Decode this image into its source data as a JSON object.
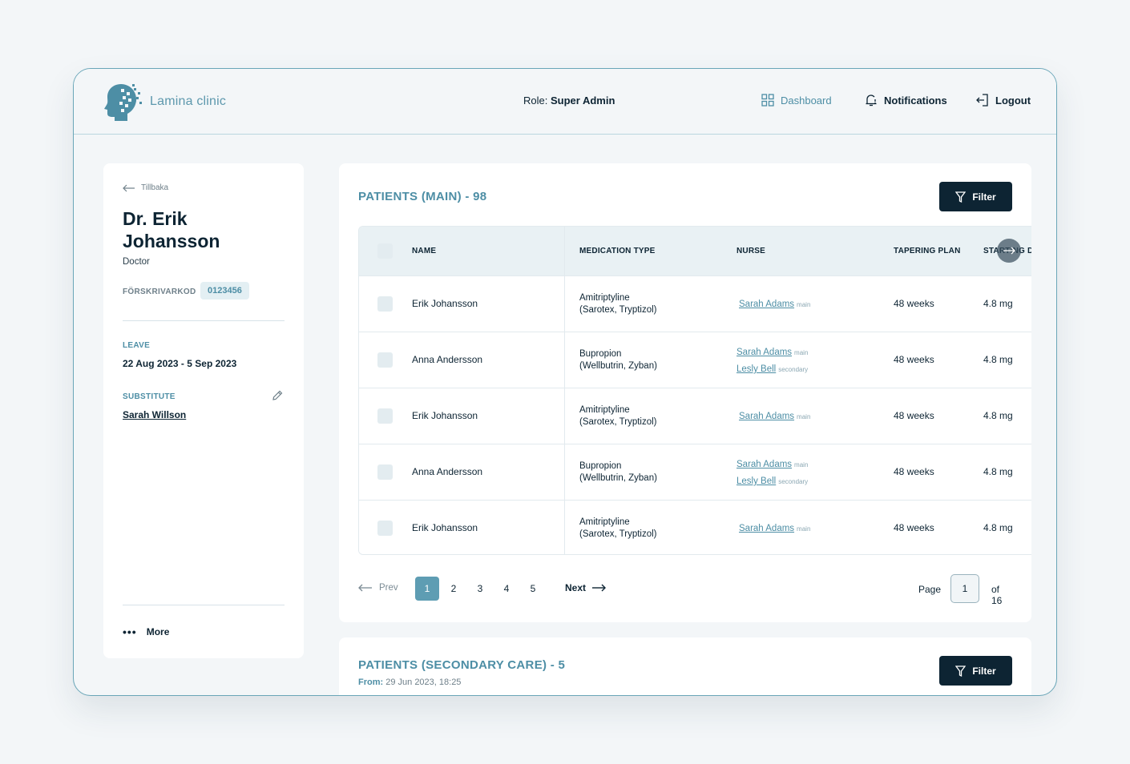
{
  "header": {
    "brand": "Lamina clinic",
    "role_label": "Role:",
    "role_value": "Super Admin",
    "nav": {
      "dashboard": "Dashboard",
      "notifications": "Notifications",
      "logout": "Logout"
    }
  },
  "profile": {
    "back_label": "Tillbaka",
    "name": "Dr. Erik Johansson",
    "role": "Doctor",
    "code_label": "FÖRSKRIVARKOD",
    "code_value": "0123456",
    "leave_label": "LEAVE",
    "leave_value": "22 Aug 2023 - 5 Sep 2023",
    "substitute_label": "SUBSTITUTE",
    "substitute_value": "Sarah Willson",
    "more_label": "More"
  },
  "main": {
    "title": "PATIENTS (MAIN) - 98",
    "filter_label": "Filter",
    "columns": [
      "NAME",
      "MEDICATION TYPE",
      "NURSE",
      "TAPERING PLAN",
      "STARTING D"
    ],
    "rows": [
      {
        "name": "Erik Johansson",
        "med_line1": "Amitriptyline",
        "med_line2": "(Sarotex, Tryptizol)",
        "nurses": [
          {
            "name": "Sarah Adams",
            "tag": "main"
          }
        ],
        "plan": "48 weeks",
        "dose": "4.8 mg"
      },
      {
        "name": "Anna Andersson",
        "med_line1": "Bupropion",
        "med_line2": "(Wellbutrin, Zyban)",
        "nurses": [
          {
            "name": "Sarah Adams",
            "tag": "main"
          },
          {
            "name": "Lesly Bell",
            "tag": "secondary"
          }
        ],
        "plan": "48 weeks",
        "dose": "4.8 mg"
      },
      {
        "name": "Erik Johansson",
        "med_line1": "Amitriptyline",
        "med_line2": "(Sarotex, Tryptizol)",
        "nurses": [
          {
            "name": "Sarah Adams",
            "tag": "main"
          }
        ],
        "plan": "48 weeks",
        "dose": "4.8 mg"
      },
      {
        "name": "Anna Andersson",
        "med_line1": "Bupropion",
        "med_line2": "(Wellbutrin, Zyban)",
        "nurses": [
          {
            "name": "Sarah Adams",
            "tag": "main"
          },
          {
            "name": "Lesly Bell",
            "tag": "secondary"
          }
        ],
        "plan": "48 weeks",
        "dose": "4.8 mg"
      },
      {
        "name": "Erik Johansson",
        "med_line1": "Amitriptyline",
        "med_line2": "(Sarotex, Tryptizol)",
        "nurses": [
          {
            "name": "Sarah Adams",
            "tag": "main"
          }
        ],
        "plan": "48 weeks",
        "dose": "4.8 mg"
      }
    ],
    "pagination": {
      "prev_label": "Prev",
      "next_label": "Next",
      "pages": [
        "1",
        "2",
        "3",
        "4",
        "5"
      ],
      "active_page": "1",
      "page_label": "Page",
      "page_input": "1",
      "of_label": "of 16"
    }
  },
  "secondary": {
    "title": "PATIENTS (SECONDARY CARE) - 5",
    "from_label": "From:",
    "from_value": "29 Jun 2023, 18:25",
    "filter_label": "Filter"
  },
  "colors": {
    "accent": "#4d8ea5",
    "dark": "#0d2433",
    "active_page": "#5e9db3",
    "border": "#6aa6b8"
  }
}
